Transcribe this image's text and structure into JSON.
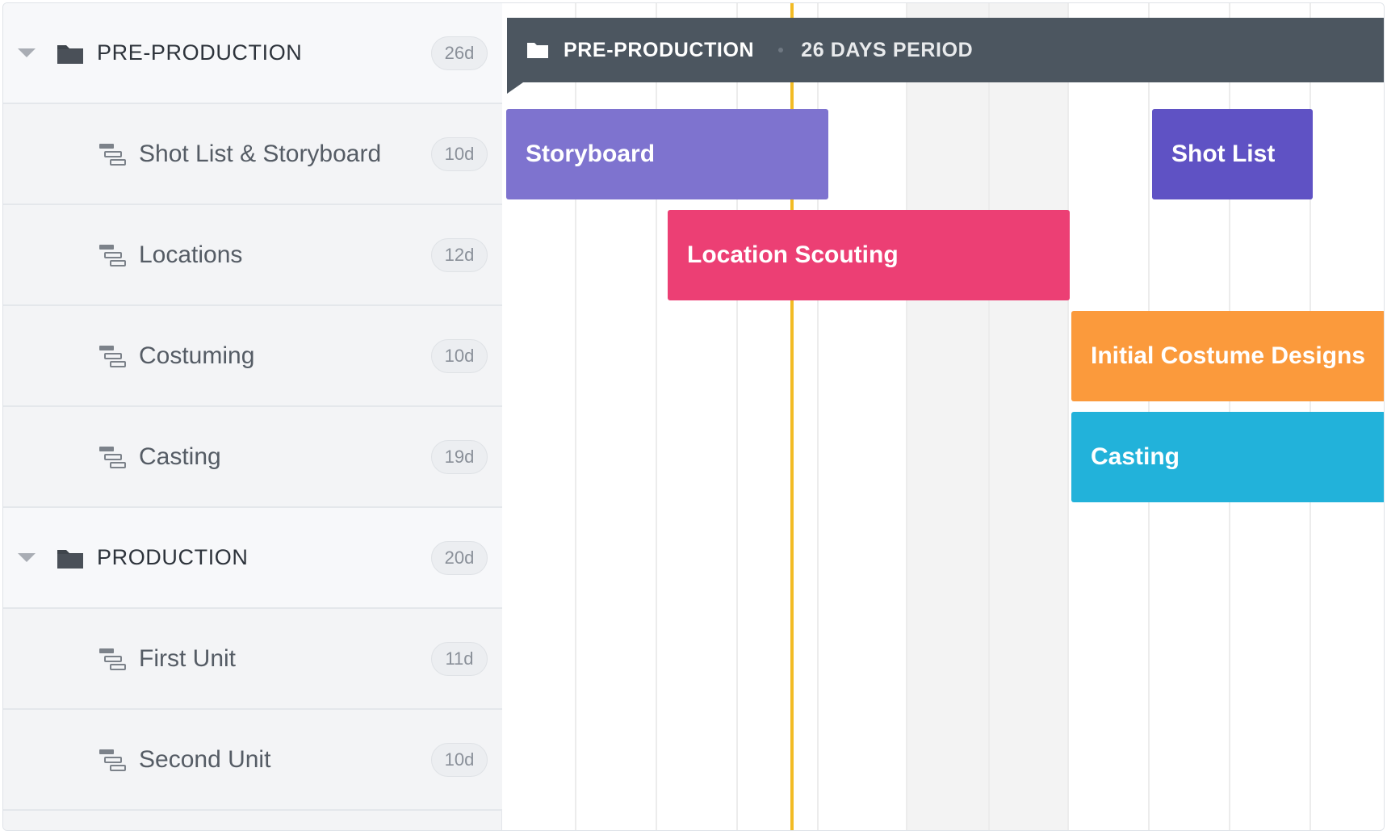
{
  "outline": {
    "groups": [
      {
        "label": "PRE-PRODUCTION",
        "duration": "26d"
      },
      {
        "label": "PRODUCTION",
        "duration": "20d"
      }
    ],
    "tasks": [
      {
        "label": "Shot List & Storyboard",
        "duration": "10d"
      },
      {
        "label": "Locations",
        "duration": "12d"
      },
      {
        "label": "Costuming",
        "duration": "10d"
      },
      {
        "label": "Casting",
        "duration": "19d"
      },
      {
        "label": "First Unit",
        "duration": "11d"
      },
      {
        "label": "Second Unit",
        "duration": "10d"
      }
    ]
  },
  "timeline": {
    "phase_header": {
      "name": "PRE-PRODUCTION",
      "period": "26 DAYS PERIOD"
    },
    "bars": [
      {
        "label": "Storyboard",
        "color": "#7e73cf"
      },
      {
        "label": "Shot List",
        "color": "#5f52c4"
      },
      {
        "label": "Location Scouting",
        "color": "#ec3f74"
      },
      {
        "label": "Initial Costume Designs",
        "color": "#fb9a3c"
      },
      {
        "label": "Casting",
        "color": "#22b2da"
      }
    ],
    "today_color": "#f2bb24",
    "header_color": "#4c5660"
  },
  "icons": {
    "group": "folder-icon",
    "task": "task-list-icon",
    "collapse": "caret-down-icon"
  }
}
